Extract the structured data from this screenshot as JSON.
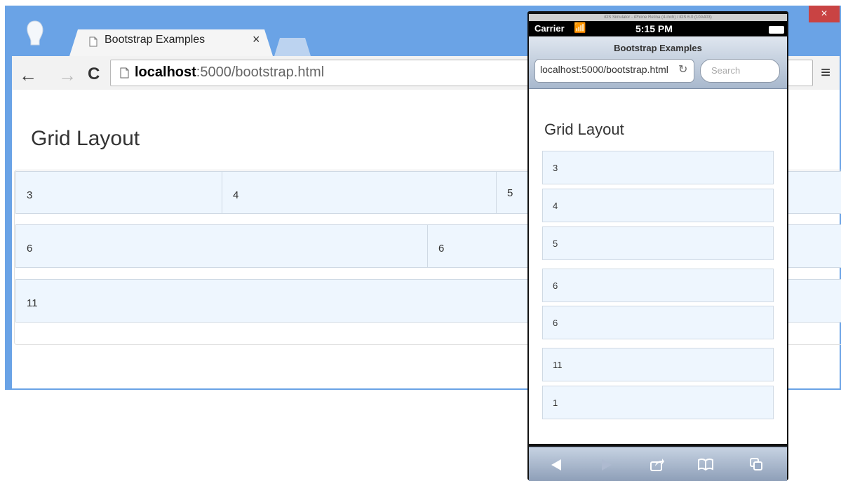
{
  "chrome": {
    "tab_title": "Bootstrap Examples",
    "tab_close": "×",
    "url_host": "localhost",
    "url_path": ":5000/bootstrap.html",
    "nav_back": "←",
    "nav_forward": "→",
    "nav_reload": "C",
    "menu": "≡",
    "window_close": "×",
    "page_title": "Grid Layout",
    "rows": [
      {
        "cells": [
          "3",
          "4",
          "5"
        ]
      },
      {
        "cells": [
          "6",
          "6"
        ]
      },
      {
        "cells": [
          "11"
        ]
      }
    ]
  },
  "ios": {
    "sim_title": "iOS Simulator - iPhone Retina (4-inch) / iOS 6.0 (10A403)",
    "carrier": "Carrier",
    "time": "5:15 PM",
    "page_title": "Bootstrap Examples",
    "url": "localhost:5000/bootstrap.html",
    "search_placeholder": "Search",
    "heading": "Grid Layout",
    "cells": [
      "3",
      "4",
      "5",
      "6",
      "6",
      "11",
      "1"
    ]
  },
  "icons": {
    "back": "back-arrow-icon",
    "forward": "forward-arrow-icon",
    "reload": "reload-icon",
    "page": "page-icon",
    "menu": "hamburger-menu-icon",
    "profile": "profile-avatar-icon",
    "ios_back": "ios-back-triangle-icon",
    "ios_forward": "ios-forward-triangle-icon",
    "ios_share": "ios-share-icon",
    "ios_bookmarks": "ios-bookmarks-book-icon",
    "ios_tabs": "ios-tabs-pages-icon"
  },
  "colors": {
    "chrome_frame": "#6aa3e6",
    "cell_bg": "#eef6fe",
    "cell_border": "#cfd9e4"
  }
}
